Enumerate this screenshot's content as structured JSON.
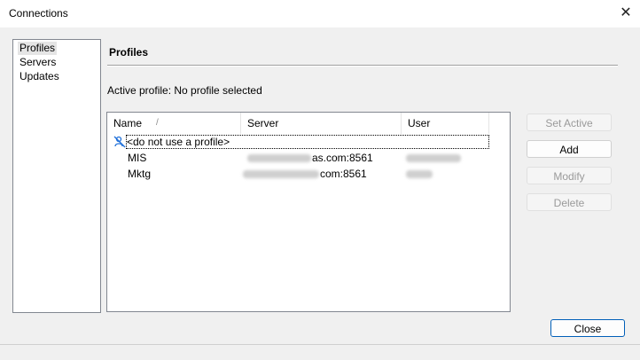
{
  "window": {
    "title": "Connections"
  },
  "nav": {
    "items": [
      "Profiles",
      "Servers",
      "Updates"
    ],
    "selected": "Profiles"
  },
  "section": {
    "title": "Profiles",
    "active_profile": "Active profile: No profile selected"
  },
  "table": {
    "columns": [
      "Name",
      "Server",
      "User"
    ],
    "sort_indicator": "/",
    "rows": [
      {
        "name": "<do not use a profile>",
        "server": "",
        "user": ""
      },
      {
        "name": "MIS",
        "server": "as.com:8561",
        "user": ""
      },
      {
        "name": "Mktg",
        "server": "com:8561",
        "user": ""
      }
    ]
  },
  "buttons": {
    "set_active": "Set Active",
    "add": "Add",
    "modify": "Modify",
    "delete": "Delete",
    "close": "Close"
  },
  "icons": {
    "no_profile": "no-profile-icon",
    "close": "close-icon"
  },
  "colors": {
    "accent": "#005fb8",
    "no_profile_icon": "#1e6fd9"
  }
}
